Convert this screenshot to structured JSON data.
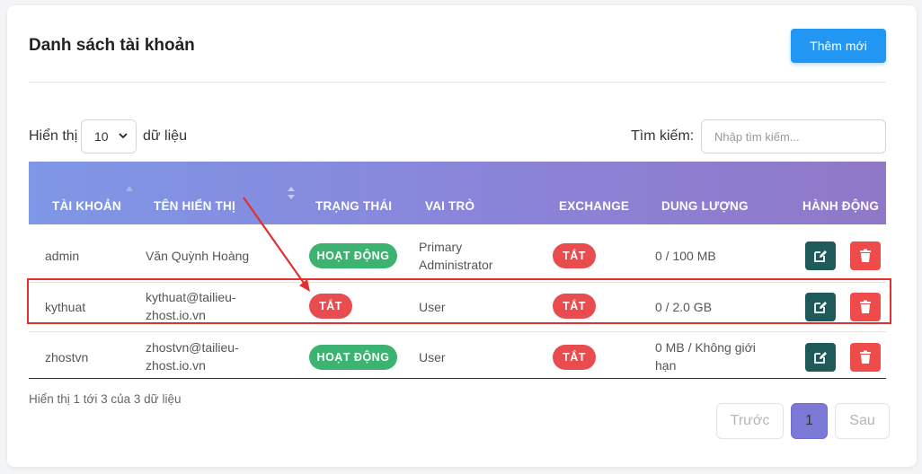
{
  "header": {
    "title": "Danh sách tài khoản",
    "add_label": "Thêm mới"
  },
  "controls": {
    "show_label": "Hiển thị",
    "page_size": "10",
    "data_label": "dữ liệu",
    "search_label": "Tìm kiếm:",
    "search_placeholder": "Nhập tìm kiếm..."
  },
  "table": {
    "columns": [
      "TÀI KHOẢN",
      "TÊN HIỂN THỊ",
      "TRẠNG THÁI",
      "VAI TRÒ",
      "EXCHANGE",
      "DUNG LƯỢNG",
      "HÀNH ĐỘNG"
    ],
    "rows": [
      {
        "account": "admin",
        "display_name": "Văn Quỳnh Hoàng",
        "status": "HOẠT ĐỘNG",
        "role": "Primary Administrator",
        "exchange": "TẮT",
        "storage": "0 / 100 MB"
      },
      {
        "account": "kythuat",
        "display_name": "kythuat@tailieu-zhost.io.vn",
        "status": "TẮT",
        "role": "User",
        "exchange": "TẮT",
        "storage": "0 / 2.0 GB"
      },
      {
        "account": "zhostvn",
        "display_name": "zhostvn@tailieu-zhost.io.vn",
        "status": "HOẠT ĐỘNG",
        "role": "User",
        "exchange": "TẮT",
        "storage": "0 MB / Không giới hạn"
      }
    ]
  },
  "footer": {
    "info": "Hiển thị 1 tới 3 của 3 dữ liệu",
    "prev": "Trước",
    "page": "1",
    "next": "Sau"
  },
  "colors": {
    "status_on": "#3cb371",
    "status_off": "#e84c4f",
    "primary": "#2196f3",
    "highlight": "#e03030"
  }
}
